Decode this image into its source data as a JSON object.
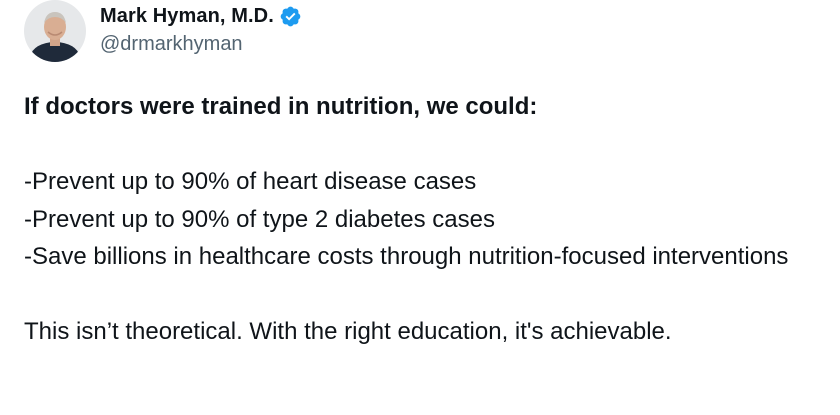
{
  "author": {
    "name": "Mark Hyman, M.D.",
    "handle": "@drmarkhyman",
    "verified_icon": "verified-badge-icon",
    "verified_color": "#1d9bf0"
  },
  "tweet": {
    "headline": "If doctors were trained in nutrition, we could:",
    "points": [
      "-Prevent up to 90% of heart disease cases",
      "-Prevent up to 90% of type 2 diabetes cases",
      "-Save billions in healthcare costs through nutrition-focused interventions"
    ],
    "closing": "This isn’t theoretical. With the right education, it's achievable."
  },
  "colors": {
    "text_primary": "#0f1419",
    "text_secondary": "#536471",
    "background": "#ffffff"
  }
}
